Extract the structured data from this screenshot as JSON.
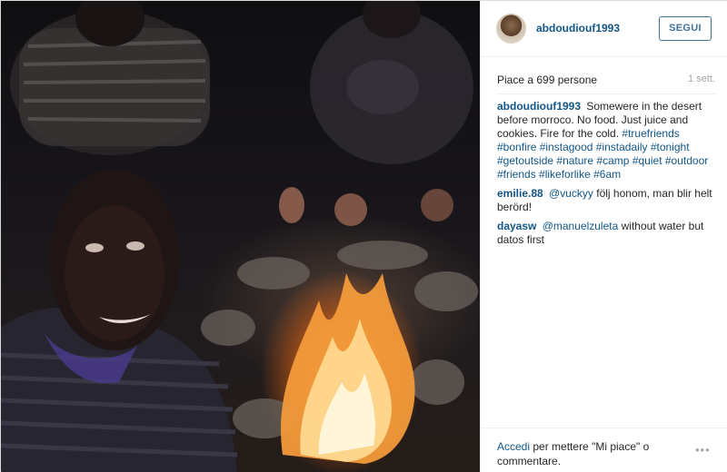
{
  "post": {
    "username": "abdoudiouf1993",
    "follow_label": "SEGUI",
    "likes": "Piace a 699 persone",
    "time_ago": "1 sett."
  },
  "caption": {
    "user": "abdoudiouf1993",
    "text": "Somewere in the desert before morroco. No food. Just juice and cookies. Fire for the cold.",
    "hashtags": [
      "#truefriends",
      "#bonfire",
      "#instagood",
      "#instadaily",
      "#tonight",
      "#getoutside",
      "#nature",
      "#camp",
      "#quiet",
      "#outdoor",
      "#friends",
      "#likeforlike",
      "#6am"
    ]
  },
  "comments": [
    {
      "user": "emilie.88",
      "mention": "@vuckyy",
      "text": "följ honom, man blir helt berörd!"
    },
    {
      "user": "dayasw",
      "mention": "@manuelzuleta",
      "text": "without water but datos first"
    }
  ],
  "footer": {
    "login_link": "Accedi",
    "login_text": "per mettere \"Mi piace\" o commentare.",
    "more_label": "•••"
  },
  "icons": {
    "more": "more-options-icon"
  }
}
